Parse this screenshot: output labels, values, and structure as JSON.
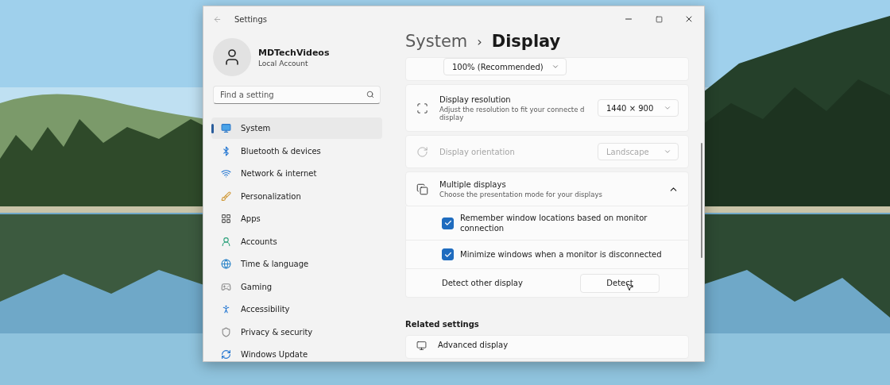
{
  "window": {
    "title": "Settings"
  },
  "profile": {
    "name": "MDTechVideos",
    "account": "Local Account"
  },
  "search": {
    "placeholder": "Find a setting"
  },
  "nav": [
    {
      "label": "System",
      "selected": true
    },
    {
      "label": "Bluetooth & devices",
      "selected": false
    },
    {
      "label": "Network & internet",
      "selected": false
    },
    {
      "label": "Personalization",
      "selected": false
    },
    {
      "label": "Apps",
      "selected": false
    },
    {
      "label": "Accounts",
      "selected": false
    },
    {
      "label": "Time & language",
      "selected": false
    },
    {
      "label": "Gaming",
      "selected": false
    },
    {
      "label": "Accessibility",
      "selected": false
    },
    {
      "label": "Privacy & security",
      "selected": false
    },
    {
      "label": "Windows Update",
      "selected": false
    }
  ],
  "breadcrumb": {
    "parent": "System",
    "separator": "›",
    "current": "Display"
  },
  "settings": [
    {
      "kind": "dropdown-only",
      "value": "100% (Recommended)"
    },
    {
      "kind": "dropdown",
      "title": "Display resolution",
      "description": "Adjust the resolution to fit your connecte d display",
      "value": "1440 × 900",
      "disabled": false
    },
    {
      "kind": "dropdown",
      "title": "Display orientation",
      "value": "Landscape",
      "disabled": true
    },
    {
      "kind": "expander",
      "title": "Multiple displays",
      "description": "Choose the presentation mode for your displays",
      "expanded": true,
      "children": [
        {
          "kind": "checkbox",
          "label": "Remember window locations based on monitor connection",
          "checked": true
        },
        {
          "kind": "checkbox",
          "label": "Minimize windows when a monitor is disconnected",
          "checked": true
        },
        {
          "kind": "button",
          "label": "Detect other display",
          "button": "Detect"
        }
      ]
    }
  ],
  "related": {
    "heading": "Related settings",
    "items": [
      {
        "title": "Advanced display"
      }
    ]
  }
}
